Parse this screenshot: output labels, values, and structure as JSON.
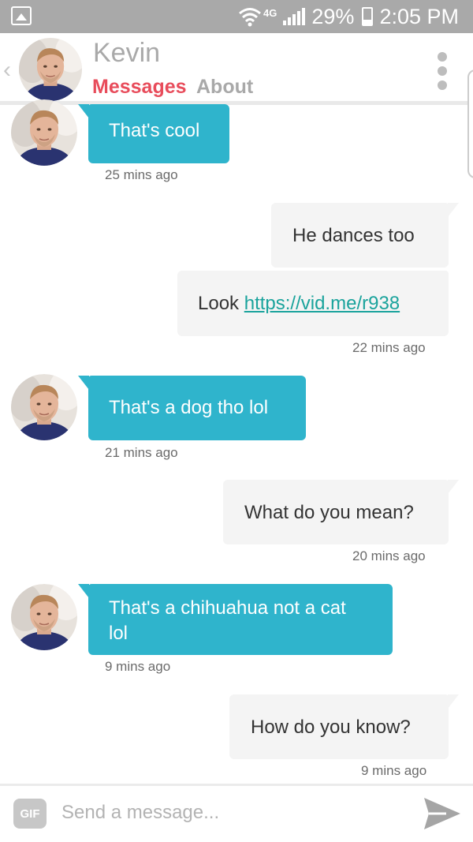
{
  "status_bar": {
    "network": "4G",
    "battery_percent": "29%",
    "time": "2:05 PM"
  },
  "header": {
    "back_icon": "chevron-left-icon",
    "name": "Kevin",
    "tabs": [
      {
        "label": "Messages",
        "active": true
      },
      {
        "label": "About",
        "active": false
      }
    ],
    "menu_icon": "more-vertical-icon"
  },
  "messages": [
    {
      "direction": "in",
      "text": "That's cool",
      "time": "25 mins ago"
    },
    {
      "direction": "out",
      "text": "He dances too"
    },
    {
      "direction": "out",
      "text_prefix": "Look",
      "link": "https://vid.me/r938",
      "time": "22 mins ago"
    },
    {
      "direction": "in",
      "text": "That's a dog tho lol",
      "time": "21 mins ago"
    },
    {
      "direction": "out",
      "text": "What do you mean?",
      "time": "20 mins ago"
    },
    {
      "direction": "in",
      "text_line1": "That's a chihuahua not a cat",
      "text_line2": "lol",
      "time": "9 mins ago"
    },
    {
      "direction": "out",
      "text": "How do you know?",
      "time": "9 mins ago"
    }
  ],
  "composer": {
    "gif_label": "GIF",
    "placeholder": "Send a message...",
    "send_icon": "send-icon"
  },
  "colors": {
    "accent": "#e84c5b",
    "incoming_bubble": "#2fb4cc",
    "outgoing_bubble": "#f4f4f4",
    "link": "#1aa39c",
    "status_bar": "#a9a9a9"
  }
}
